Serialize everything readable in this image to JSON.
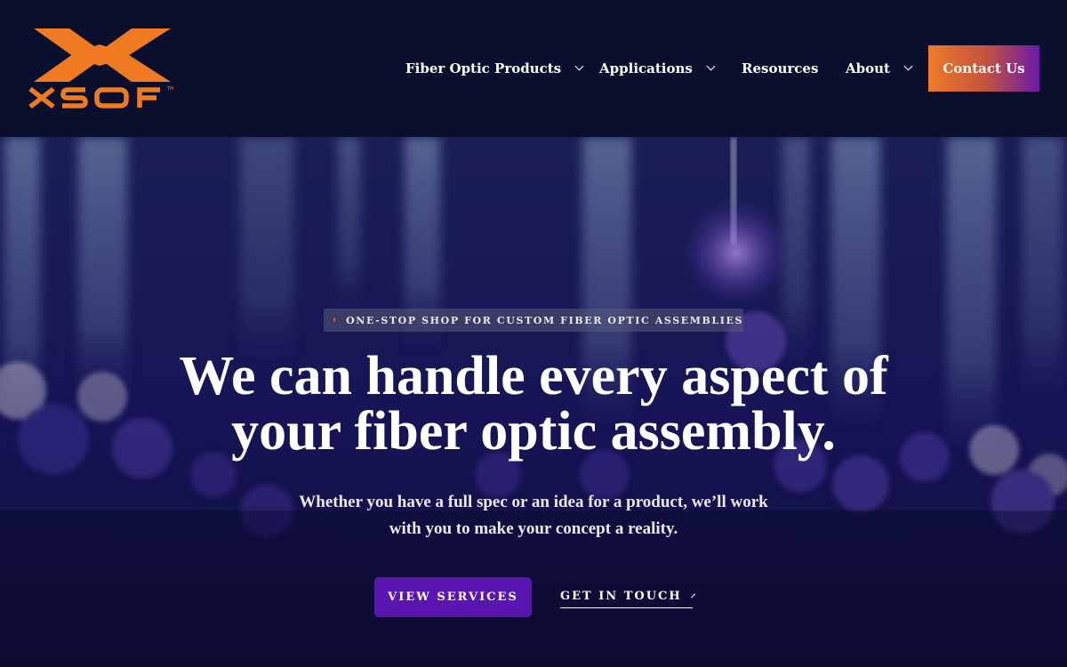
{
  "brand": {
    "logo_text": "XSOF",
    "logo_color": "#f07a22"
  },
  "nav": {
    "items": [
      {
        "label": "Fiber Optic Products",
        "has_dropdown": true
      },
      {
        "label": "Applications",
        "has_dropdown": true
      },
      {
        "label": "Resources",
        "has_dropdown": false
      },
      {
        "label": "About",
        "has_dropdown": true
      }
    ],
    "contact_label": "Contact Us"
  },
  "hero": {
    "eyebrow": "ONE-STOP SHOP FOR CUSTOM FIBER OPTIC ASSEMBLIES",
    "headline_line1": "We can handle every aspect of",
    "headline_line2": "your fiber optic assembly.",
    "subtext_line1": "Whether you have a full spec or an idea for a product, we’ll work",
    "subtext_line2": "with you to make your concept a reality.",
    "primary_cta": "VIEW SERVICES",
    "secondary_cta": "GET IN TOUCH"
  },
  "colors": {
    "header_bg": "#0a0f2e",
    "accent_orange": "#f07a22",
    "accent_purple": "#5a14b0",
    "hero_bg": "#14124a"
  },
  "icons": {
    "eyebrow_icon": "lightning-bolt-icon",
    "nav_dropdown_icon": "chevron-down-icon",
    "cta_arrow_icon": "chevron-right-icon"
  }
}
